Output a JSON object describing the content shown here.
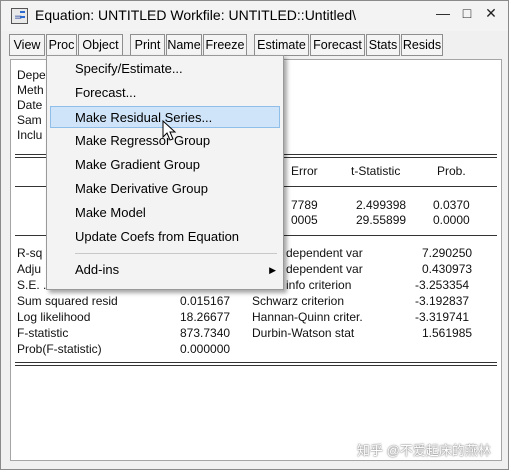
{
  "window": {
    "title": "Equation: UNTITLED   Workfile: UNTITLED::Untitled\\",
    "controls": [
      "—",
      "□",
      "✕"
    ]
  },
  "toolbar": [
    "View",
    "Proc",
    "Object",
    "Print",
    "Name",
    "Freeze",
    "Estimate",
    "Forecast",
    "Stats",
    "Resids"
  ],
  "content": {
    "left_labels": [
      "Depe",
      "Meth",
      "Date",
      "Sam",
      "Inclu"
    ],
    "coef_header": [
      "Error",
      "t-Statistic",
      "Prob."
    ],
    "coef_rows": [
      [
        "7789",
        "2.499398",
        "0.0370"
      ],
      [
        "0005",
        "29.55899",
        "0.0000"
      ]
    ],
    "stats_partial": [
      "R-sq",
      "Adju",
      "S.E. ..."
    ],
    "stats_right_partial": [
      [
        "dependent var",
        "7.290250"
      ],
      [
        "dependent var",
        "0.430973"
      ],
      [
        "info criterion",
        "-3.253354"
      ]
    ],
    "stats_rows": [
      [
        "Sum squared resid",
        "0.015167",
        "Schwarz criterion",
        "-3.192837"
      ],
      [
        "Log likelihood",
        "18.26677",
        "Hannan-Quinn criter.",
        "-3.319741"
      ],
      [
        "F-statistic",
        "873.7340",
        "Durbin-Watson stat",
        "1.561985"
      ],
      [
        "Prob(F-statistic)",
        "0.000000",
        "",
        ""
      ]
    ]
  },
  "proc_menu": {
    "items": [
      "Specify/Estimate...",
      "Forecast...",
      "Make Residual Series...",
      "Make Regressor Group",
      "Make Gradient Group",
      "Make Derivative Group",
      "Make Model",
      "Update Coefs from Equation",
      "Add-ins"
    ],
    "highlighted": "Make Residual Series..."
  },
  "watermark": "知乎 @不爱起床的燕林"
}
